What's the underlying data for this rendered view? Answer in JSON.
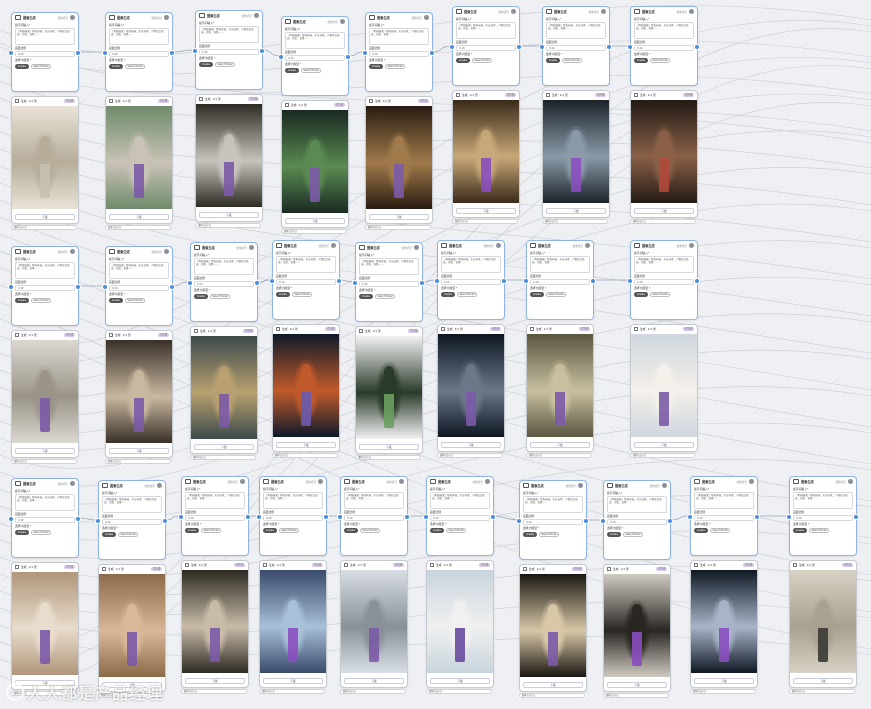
{
  "canvas": {
    "background": "#eef0f4",
    "accent": "#4a8fe0"
  },
  "node_template": {
    "agent_title": "图像生成",
    "meta": "图像模型",
    "prompt_label": "提示词输入*",
    "prompt_text": "（风格描述）紫色丝袜、东方元素、人物站立姿态、光影、背景……",
    "ratio_label": "画面比例",
    "ratio_value": "9:16",
    "model_label": "选择大模型 *",
    "generate_label": "Create",
    "model_button": "Select Model",
    "image_label": "生成",
    "image_meta": "1/1 张",
    "image_badge": "已生成",
    "download_label": "下载",
    "footer_text": "图像生成节点"
  },
  "nodes": [
    {
      "id": "n1",
      "palette": [
        "#e9e3d6",
        "#b6ad9a",
        "#c9c1b0"
      ]
    },
    {
      "id": "n2",
      "palette": [
        "#6f8a6a",
        "#c9c3b6",
        "#7b5aa8"
      ]
    },
    {
      "id": "n3",
      "palette": [
        "#2e2a24",
        "#c7c3bd",
        "#7b5aa8"
      ]
    },
    {
      "id": "n4",
      "palette": [
        "#1a2a22",
        "#5b8a52",
        "#7b5aa8"
      ]
    },
    {
      "id": "n5",
      "palette": [
        "#2a1c12",
        "#a07a4a",
        "#7b5aa8"
      ]
    },
    {
      "id": "n6",
      "palette": [
        "#3a2a1a",
        "#c8a878",
        "#8a4ec0"
      ]
    },
    {
      "id": "n7",
      "palette": [
        "#1c232a",
        "#8a9aa8",
        "#8a4ec0"
      ]
    },
    {
      "id": "n8",
      "palette": [
        "#231a14",
        "#8a6048",
        "#b0483a"
      ]
    },
    {
      "id": "n9",
      "palette": [
        "#dcd8d0",
        "#9a9488",
        "#7b5aa8"
      ]
    },
    {
      "id": "n10",
      "palette": [
        "#3a3028",
        "#c8b8a0",
        "#7b5aa8"
      ]
    },
    {
      "id": "n11",
      "palette": [
        "#3c4a4a",
        "#b8a070",
        "#7b5aa8"
      ]
    },
    {
      "id": "n12",
      "palette": [
        "#0e1a2a",
        "#c05a2a",
        "#6a5ab0"
      ]
    },
    {
      "id": "n13",
      "palette": [
        "#f2f2f2",
        "#2a3a2a",
        "#6aa060"
      ]
    },
    {
      "id": "n14",
      "palette": [
        "#0e1622",
        "#6a7888",
        "#7b5aa8"
      ]
    },
    {
      "id": "n15",
      "palette": [
        "#5a5640",
        "#c8c0a0",
        "#7b5aa8"
      ]
    },
    {
      "id": "n16",
      "palette": [
        "#cfd6de",
        "#f4f0ea",
        "#7b5aa8"
      ]
    },
    {
      "id": "n17",
      "palette": [
        "#b0967a",
        "#e8dccc",
        "#7b5aa8"
      ]
    },
    {
      "id": "n18",
      "palette": [
        "#8a6a48",
        "#d8b898",
        "#7b5aa8"
      ]
    },
    {
      "id": "n19",
      "palette": [
        "#2e2a22",
        "#c8bca8",
        "#7b5aa8"
      ]
    },
    {
      "id": "n20",
      "palette": [
        "#3a4a6a",
        "#a8c0d8",
        "#8a4ec0"
      ]
    },
    {
      "id": "n21",
      "palette": [
        "#d8dee4",
        "#8a9098",
        "#7b5aa8"
      ]
    },
    {
      "id": "n22",
      "palette": [
        "#c8d4dc",
        "#f0f0f0",
        "#6a4aa0"
      ]
    },
    {
      "id": "n23",
      "palette": [
        "#1a1612",
        "#d8c8a8",
        "#7b5aa8"
      ]
    },
    {
      "id": "n24",
      "palette": [
        "#cfcac2",
        "#2a2622",
        "#8a4ec0"
      ]
    },
    {
      "id": "n25",
      "palette": [
        "#101824",
        "#a8b4c8",
        "#8a4ec0"
      ]
    },
    {
      "id": "n26",
      "palette": [
        "#d8d2c4",
        "#a8a090",
        "#3a3a36"
      ]
    }
  ],
  "watermark": "人人都是产品经理"
}
